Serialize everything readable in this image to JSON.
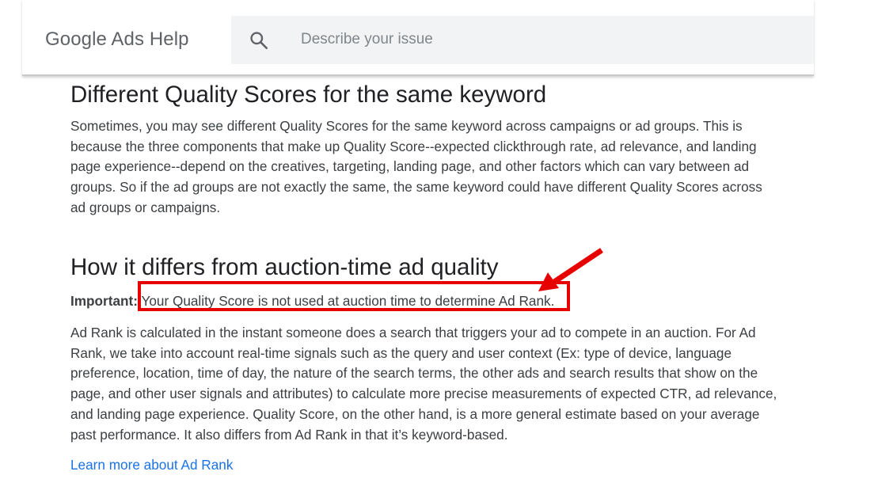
{
  "header": {
    "brand": "Google Ads Help",
    "search": {
      "placeholder": "Describe your issue",
      "value": "",
      "icon": "search-icon"
    }
  },
  "sections": [
    {
      "title": "Different Quality Scores for the same keyword",
      "paragraph": "Sometimes, you may see different Quality Scores for the same keyword across campaigns or ad groups. This is because the three components that make up Quality Score--expected clickthrough rate, ad relevance, and landing page experience--depend on the creatives, targeting, landing page, and other factors which can vary between ad groups. So if the ad groups are not exactly the same, the same keyword could have different Quality Scores across ad groups or campaigns."
    },
    {
      "title": "How it differs from auction-time ad quality",
      "important_label": "Important:",
      "important_text": " Your Quality Score is not used at auction time to determine Ad Rank.",
      "paragraph": "Ad Rank is calculated in the instant someone does a search that triggers your ad to compete in an auction. For Ad Rank, we take into account real-time signals such as the query and user context (Ex: type of device, language preference, location, time of day, the nature of the search terms, the other ads and search results that show on the page, and other user signals and attributes) to calculate more precise measurements of expected CTR, ad relevance, and landing page experience. Quality Score, on the other hand, is a more general estimate based on your average past performance. It also differs from Ad Rank in that it’s keyword-based.",
      "link": "Learn more about Ad Rank"
    }
  ],
  "colors": {
    "link": "#1a73e8",
    "annotation": "#e60000",
    "search_bg": "#f1f3f4"
  }
}
